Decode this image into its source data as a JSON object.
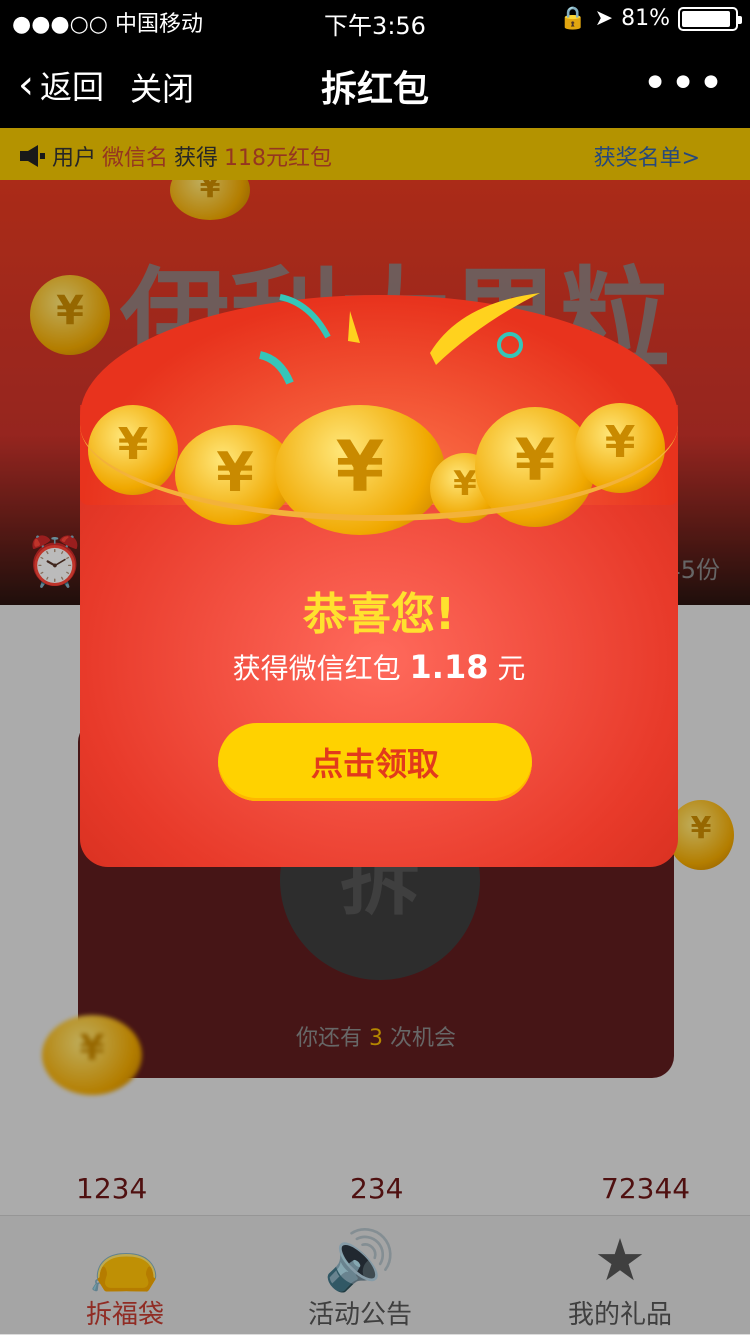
{
  "status_bar": {
    "carrier": "●●●○○ 中国移动",
    "time": "下午3:56",
    "battery": "81%"
  },
  "nav": {
    "back": "返回",
    "close": "关闭",
    "title": "拆红包",
    "more": "•••"
  },
  "ticker": {
    "prefix": "用户",
    "username": "微信名",
    "verb": "获得",
    "amount": "118元红包",
    "winners_link": "获奖名单>"
  },
  "banner": {
    "brand": "伊利大果粒",
    "remaining": "45份"
  },
  "card": {
    "tear_label": "拆",
    "chance_prefix": "你还有",
    "chance_count": "3",
    "chance_suffix": "次机会"
  },
  "stats": [
    "1234",
    "234",
    "72344"
  ],
  "tabs": [
    {
      "label": "拆福袋",
      "icon": "lucky-bag-icon",
      "active": true
    },
    {
      "label": "活动公告",
      "icon": "speaker-icon",
      "active": false
    },
    {
      "label": "我的礼品",
      "icon": "star-icon",
      "active": false
    }
  ],
  "popup": {
    "congrats": "恭喜您!",
    "got_prefix": "获得微信红包",
    "amount": "1.18",
    "unit": "元",
    "claim_button": "点击领取"
  },
  "colors": {
    "accent_red": "#e83a2a",
    "gold": "#ffd200",
    "ticker_bg": "#f1c400"
  }
}
